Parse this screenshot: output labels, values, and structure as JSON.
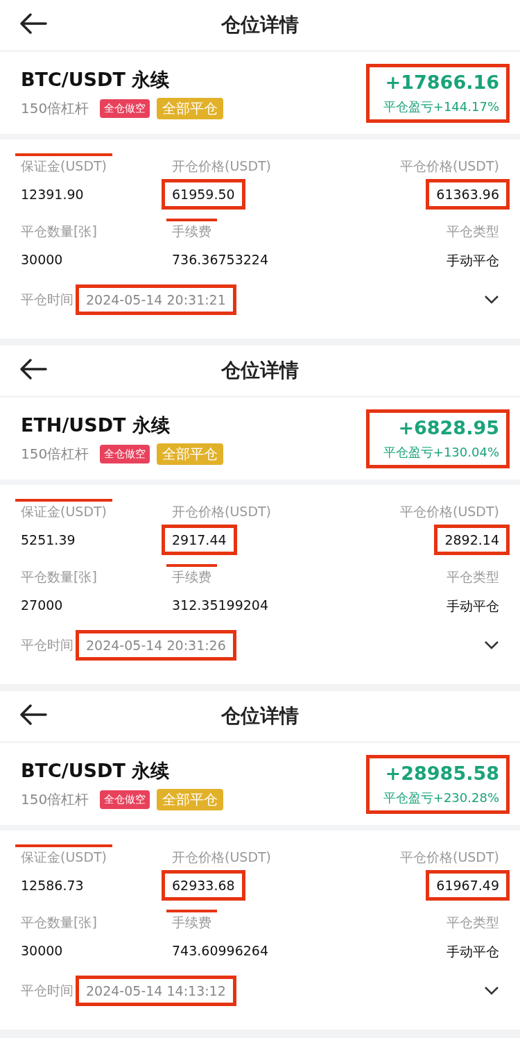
{
  "panels": [
    {
      "title": "仓位详情",
      "symbol": "BTC/USDT 永续",
      "leverage": "150倍杠杆",
      "tags": [
        {
          "text": "全仓做空",
          "kind": "side"
        },
        {
          "text": "全部平仓",
          "kind": "status"
        }
      ],
      "pnl": {
        "amount": "+17866.16",
        "ratio": "平仓盈亏+144.17%",
        "boxed": true
      },
      "fields": [
        {
          "label": "保证金(USDT)",
          "value": "12391.90",
          "label_struck": true,
          "value_boxed": false
        },
        {
          "label": "开仓价格(USDT)",
          "value": "61959.50",
          "label_struck": false,
          "value_boxed": true
        },
        {
          "label": "平仓价格(USDT)",
          "value": "61363.96",
          "label_struck": false,
          "value_boxed": true
        },
        {
          "label": "平仓数量[张]",
          "value": "30000",
          "label_struck": false,
          "value_boxed": false
        },
        {
          "label": "手续费",
          "value": "736.36753224",
          "label_struck": true,
          "value_boxed": false
        },
        {
          "label": "平仓类型",
          "value": "手动平仓",
          "label_struck": false,
          "value_boxed": false
        }
      ],
      "time": {
        "label": "平仓时间",
        "value": "2024-05-14 20:31:21",
        "boxed": true
      }
    },
    {
      "title": "仓位详情",
      "symbol": "ETH/USDT 永续",
      "leverage": "150倍杠杆",
      "tags": [
        {
          "text": "全仓做空",
          "kind": "side"
        },
        {
          "text": "全部平仓",
          "kind": "status"
        }
      ],
      "pnl": {
        "amount": "+6828.95",
        "ratio": "平仓盈亏+130.04%",
        "boxed": true
      },
      "fields": [
        {
          "label": "保证金(USDT)",
          "value": "5251.39",
          "label_struck": true,
          "value_boxed": false
        },
        {
          "label": "开仓价格(USDT)",
          "value": "2917.44",
          "label_struck": false,
          "value_boxed": true
        },
        {
          "label": "平仓价格(USDT)",
          "value": "2892.14",
          "label_struck": false,
          "value_boxed": true
        },
        {
          "label": "平仓数量[张]",
          "value": "27000",
          "label_struck": false,
          "value_boxed": false
        },
        {
          "label": "手续费",
          "value": "312.35199204",
          "label_struck": true,
          "value_boxed": false
        },
        {
          "label": "平仓类型",
          "value": "手动平仓",
          "label_struck": false,
          "value_boxed": false
        }
      ],
      "time": {
        "label": "平仓时间",
        "value": "2024-05-14 20:31:26",
        "boxed": true
      }
    },
    {
      "title": "仓位详情",
      "symbol": "BTC/USDT 永续",
      "leverage": "150倍杠杆",
      "tags": [
        {
          "text": "全仓做空",
          "kind": "side"
        },
        {
          "text": "全部平仓",
          "kind": "status"
        }
      ],
      "pnl": {
        "amount": "+28985.58",
        "ratio": "平仓盈亏+230.28%",
        "boxed": true
      },
      "fields": [
        {
          "label": "保证金(USDT)",
          "value": "12586.73",
          "label_struck": true,
          "value_boxed": false
        },
        {
          "label": "开仓价格(USDT)",
          "value": "62933.68",
          "label_struck": false,
          "value_boxed": true
        },
        {
          "label": "平仓价格(USDT)",
          "value": "61967.49",
          "label_struck": false,
          "value_boxed": true
        },
        {
          "label": "平仓数量[张]",
          "value": "30000",
          "label_struck": false,
          "value_boxed": false
        },
        {
          "label": "手续费",
          "value": "743.60996264",
          "label_struck": true,
          "value_boxed": false
        },
        {
          "label": "平仓类型",
          "value": "手动平仓",
          "label_struck": false,
          "value_boxed": false
        }
      ],
      "time": {
        "label": "平仓时间",
        "value": "2024-05-14 14:13:12",
        "boxed": true
      }
    }
  ]
}
